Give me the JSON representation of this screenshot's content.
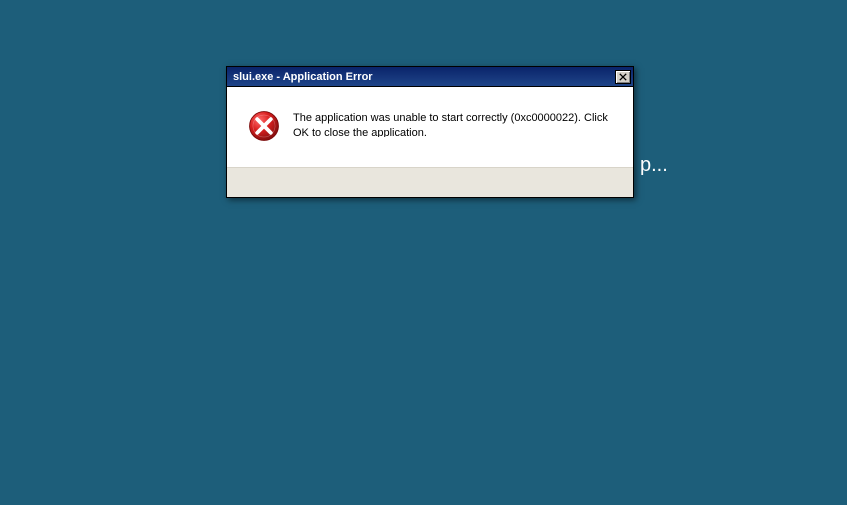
{
  "background": {
    "partial_text": "p..."
  },
  "dialog": {
    "title": "slui.exe - Application Error",
    "message": "The application was unable to start correctly (0xc0000022). Click OK to close the application.",
    "close_label": "Close"
  }
}
